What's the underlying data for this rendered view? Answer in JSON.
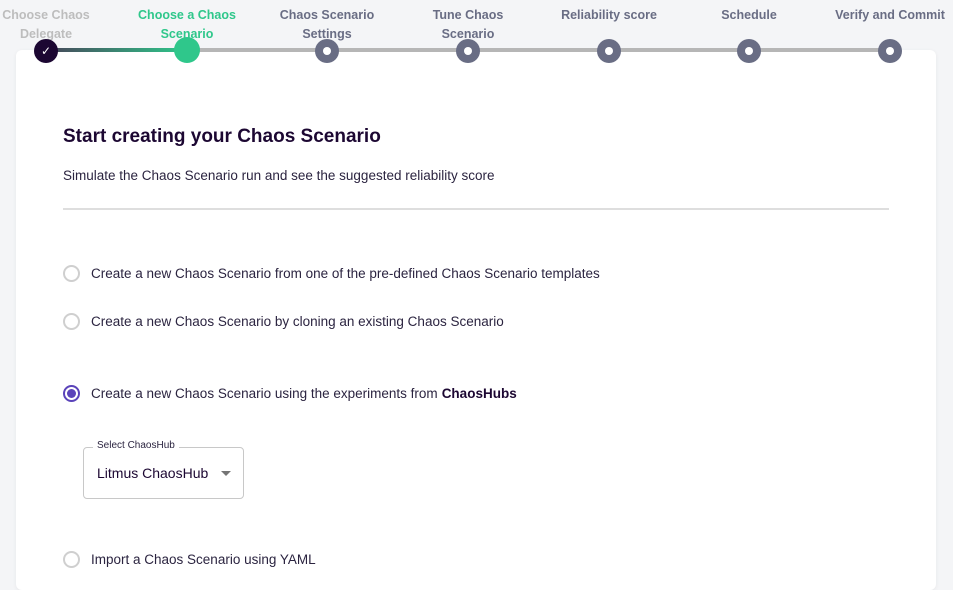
{
  "stepper": {
    "steps": [
      {
        "label_line1": "Choose Chaos",
        "label_line2": "Delegate",
        "state": "complete"
      },
      {
        "label_line1": "Choose a Chaos",
        "label_line2": "Scenario",
        "state": "active"
      },
      {
        "label_line1": "Chaos Scenario",
        "label_line2": "Settings",
        "state": "pending"
      },
      {
        "label_line1": "Tune Chaos",
        "label_line2": "Scenario",
        "state": "pending"
      },
      {
        "label_line1": "Reliability score",
        "label_line2": "",
        "state": "pending"
      },
      {
        "label_line1": "Schedule",
        "label_line2": "",
        "state": "pending"
      },
      {
        "label_line1": "Verify and Commit",
        "label_line2": "",
        "state": "pending"
      }
    ],
    "colors": {
      "complete": "#1c0732",
      "active": "#2fc78b",
      "pending": "#696d84"
    }
  },
  "main": {
    "title": "Start creating your Chaos Scenario",
    "subtitle": "Simulate the Chaos Scenario run and see the suggested reliability score",
    "options": [
      {
        "label": "Create a new Chaos Scenario from one of the pre-defined Chaos Scenario templates",
        "bold": "",
        "checked": false
      },
      {
        "label": "Create a new Chaos Scenario by cloning an existing Chaos Scenario",
        "bold": "",
        "checked": false
      },
      {
        "label": "Create a new Chaos Scenario using the experiments from",
        "bold": "ChaosHubs",
        "checked": true
      },
      {
        "label": "Import a Chaos Scenario using YAML",
        "bold": "",
        "checked": false
      }
    ],
    "select_chaoshub": {
      "legend": "Select ChaosHub",
      "value": "Litmus ChaosHub"
    }
  }
}
